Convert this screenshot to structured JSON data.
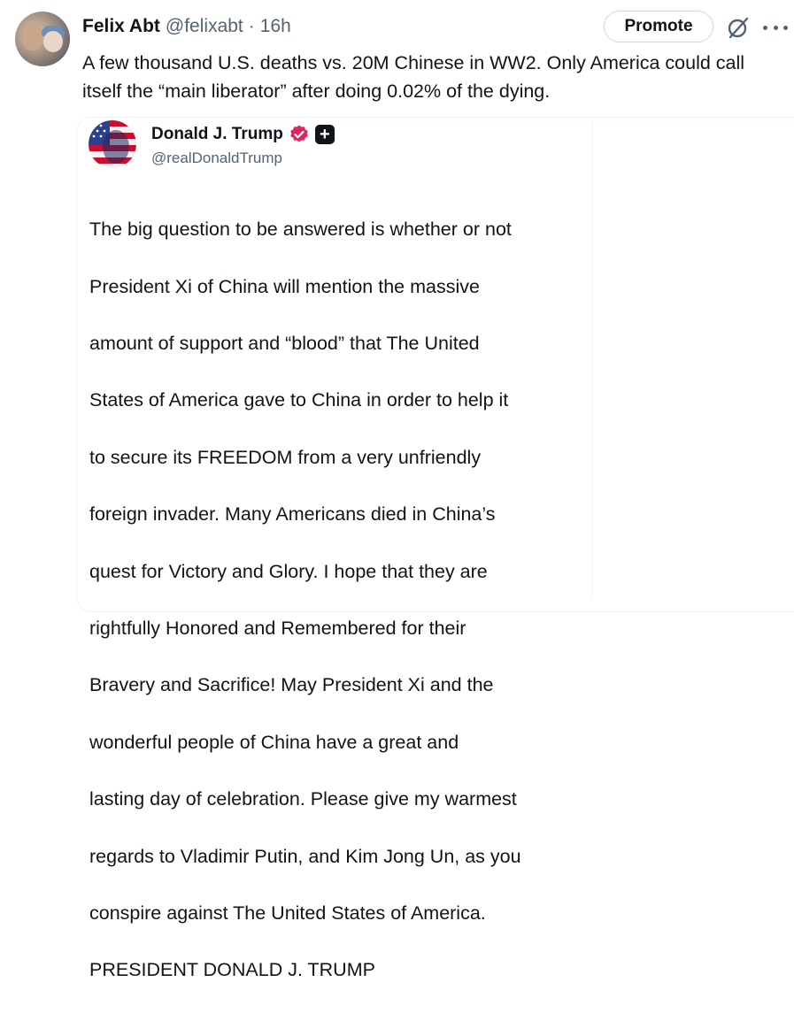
{
  "post": {
    "author_name": "Felix Abt",
    "author_handle": "@felixabt",
    "separator": "·",
    "time": "16h",
    "promote_label": "Promote",
    "text": "A few thousand U.S. deaths vs. 20M Chinese in WW2. Only America could call\nitself the “main liberator” after doing 0.02% of the dying."
  },
  "quoted_post": {
    "author_name": "Donald J. Trump",
    "author_handle": "@realDonaldTrump",
    "lines": [
      "The big question to be answered is whether or not",
      "President Xi of China will mention the massive",
      "amount of support and “blood” that The United",
      "States of America gave to China in order to help it",
      "to secure its FREEDOM from a very unfriendly",
      "foreign invader. Many Americans died in China’s",
      "quest for Victory and Glory. I hope that they are",
      "rightfully Honored and Remembered for their",
      "Bravery and Sacrifice! May President Xi and the",
      "wonderful people of China have a great and",
      "lasting day of celebration. Please give my warmest",
      "regards to Vladimir Putin, and Kim Jong Un, as you",
      "conspire against The United States of America.",
      "PRESIDENT DONALD J. TRUMP"
    ]
  },
  "icons": {
    "grok": "grok-icon",
    "more": "more-icon",
    "verified": "verified-badge-icon",
    "affiliate": "affiliate-badge-icon"
  },
  "colors": {
    "text_primary": "#0f1419",
    "text_secondary": "#536471",
    "border": "#cfd9de",
    "verified_badge": "#e0245e"
  }
}
